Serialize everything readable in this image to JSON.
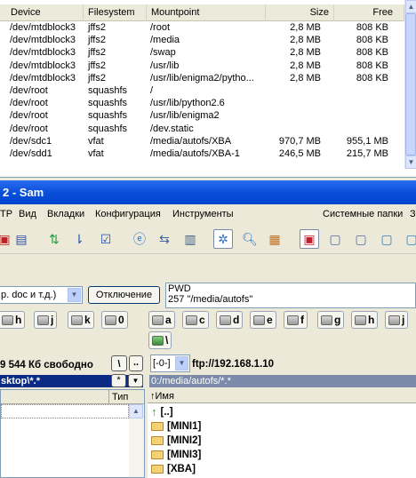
{
  "disk_table": {
    "columns": [
      "Device",
      "Filesystem",
      "Mountpoint",
      "Size",
      "Free"
    ],
    "rows": [
      [
        "/dev/mtdblock3",
        "jffs2",
        "/root",
        "2,8 MB",
        "808 KB"
      ],
      [
        "/dev/mtdblock3",
        "jffs2",
        "/media",
        "2,8 MB",
        "808 KB"
      ],
      [
        "/dev/mtdblock3",
        "jffs2",
        "/swap",
        "2,8 MB",
        "808 KB"
      ],
      [
        "/dev/mtdblock3",
        "jffs2",
        "/usr/lib",
        "2,8 MB",
        "808 KB"
      ],
      [
        "/dev/mtdblock3",
        "jffs2",
        "/usr/lib/enigma2/pytho...",
        "2,8 MB",
        "808 KB"
      ],
      [
        "/dev/root",
        "squashfs",
        "/",
        "",
        ""
      ],
      [
        "/dev/root",
        "squashfs",
        "/usr/lib/python2.6",
        "",
        ""
      ],
      [
        "/dev/root",
        "squashfs",
        "/usr/lib/enigma2",
        "",
        ""
      ],
      [
        "/dev/root",
        "squashfs",
        "/dev.static",
        "",
        ""
      ],
      [
        "/dev/sdc1",
        "vfat",
        "/media/autofs/XBA",
        "970,7 MB",
        "955,1 MB"
      ],
      [
        "/dev/sdd1",
        "vfat",
        "/media/autofs/XBA-1",
        "246,5 MB",
        "215,7 MB"
      ]
    ]
  },
  "titlebar": {
    "title": "2 - Sam"
  },
  "menu": {
    "items": [
      "TP",
      "Вид",
      "Вкладки",
      "Конфигурация",
      "Инструменты"
    ],
    "right": "Системные папки",
    "right_cut": "З"
  },
  "filter": {
    "value": "р. doc и т.д.)",
    "disconnect": "Отключение"
  },
  "log": {
    "line1": "PWD",
    "line2": "257 \"/media/autofs\""
  },
  "left_drives": [
    "h",
    "j",
    "k",
    "0"
  ],
  "right_drives": [
    "a",
    "c",
    "d",
    "e",
    "f",
    "g",
    "h",
    "j"
  ],
  "right_extra": "\\",
  "left_status": {
    "free": "9 544 Кб свободно",
    "root_btn": "\\",
    "up_btn": ".."
  },
  "right_status": {
    "combo": "[-0-]",
    "ftp": "ftp://192.168.1.10"
  },
  "left_path": "sktop\\*.*",
  "left_star": "*",
  "right_path": "0:/media/autofs/*.*",
  "left_header": {
    "type": "Тип"
  },
  "right_header": {
    "name": "↑Имя"
  },
  "right_files": [
    "[..]",
    "[MINI1]",
    "[MINI2]",
    "[MINI3]",
    "[XBA]"
  ]
}
